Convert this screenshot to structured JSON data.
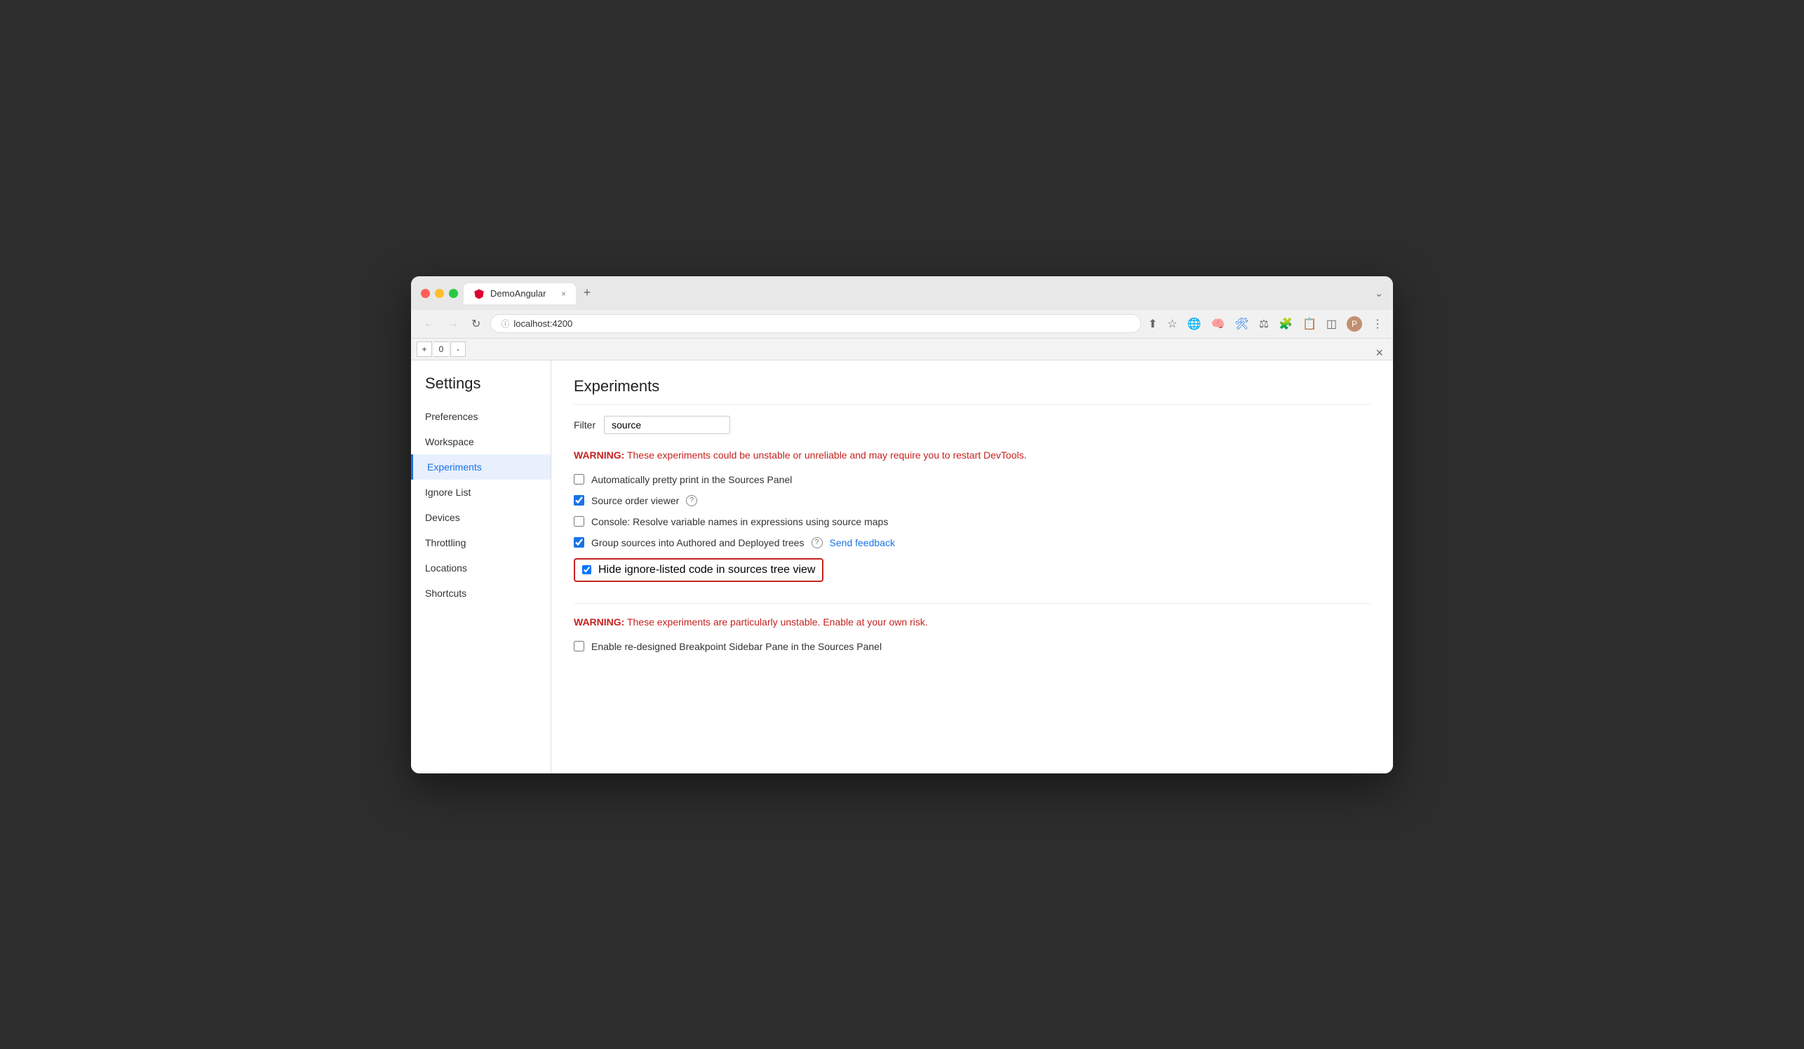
{
  "browser": {
    "tab_title": "DemoAngular",
    "tab_close": "×",
    "new_tab": "+",
    "url": "localhost:4200",
    "chevron_down": "⌄"
  },
  "devtools": {
    "close": "×",
    "zoom_plus": "+",
    "zoom_value": "0",
    "zoom_minus": "-"
  },
  "sidebar": {
    "title": "Settings",
    "items": [
      {
        "id": "preferences",
        "label": "Preferences"
      },
      {
        "id": "workspace",
        "label": "Workspace"
      },
      {
        "id": "experiments",
        "label": "Experiments",
        "active": true
      },
      {
        "id": "ignore-list",
        "label": "Ignore List"
      },
      {
        "id": "devices",
        "label": "Devices"
      },
      {
        "id": "throttling",
        "label": "Throttling"
      },
      {
        "id": "locations",
        "label": "Locations"
      },
      {
        "id": "shortcuts",
        "label": "Shortcuts"
      }
    ]
  },
  "main": {
    "title": "Experiments",
    "filter_label": "Filter",
    "filter_value": "source",
    "filter_placeholder": "",
    "warning1": "WARNING:",
    "warning1_text": " These experiments could be unstable or unreliable and may require you to restart DevTools.",
    "checkbox1_label": "Automatically pretty print in the Sources Panel",
    "checkbox1_checked": false,
    "checkbox2_label": "Source order viewer",
    "checkbox2_checked": true,
    "checkbox3_label": "Console: Resolve variable names in expressions using source maps",
    "checkbox3_checked": false,
    "checkbox4_label": "Group sources into Authored and Deployed trees",
    "checkbox4_checked": true,
    "send_feedback": "Send feedback",
    "checkbox5_label": "Hide ignore-listed code in sources tree view",
    "checkbox5_checked": true,
    "warning2": "WARNING:",
    "warning2_text": " These experiments are particularly unstable. Enable at your own risk.",
    "checkbox6_label": "Enable re-designed Breakpoint Sidebar Pane in the Sources Panel",
    "checkbox6_checked": false,
    "help_icon": "?",
    "help_icon2": "?"
  }
}
